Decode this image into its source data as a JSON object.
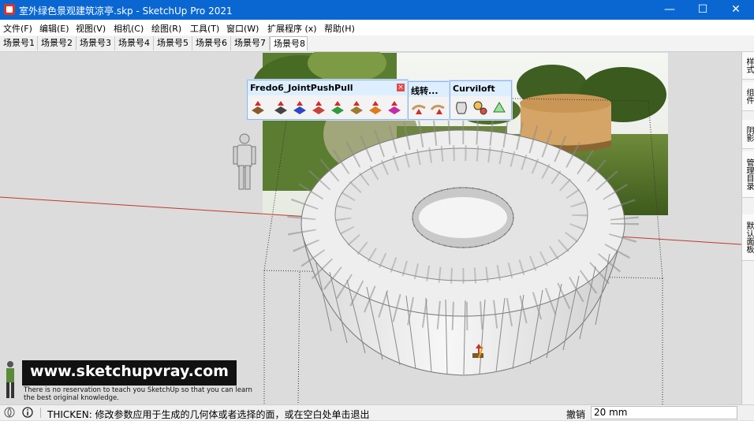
{
  "window": {
    "title": "室外绿色景观建筑凉亭.skp - SketchUp Pro 2021",
    "minimize": "—",
    "maximize": "☐",
    "close": "✕"
  },
  "menu": [
    "文件(F)",
    "编辑(E)",
    "视图(V)",
    "相机(C)",
    "绘图(R)",
    "工具(T)",
    "窗口(W)",
    "扩展程序 (x)",
    "帮助(H)"
  ],
  "scenes": {
    "tabs": [
      "场景号1",
      "场景号2",
      "场景号3",
      "场景号4",
      "场景号5",
      "场景号6",
      "场景号7",
      "场景号8"
    ],
    "active_index": 7
  },
  "toolbars": [
    {
      "title": "Fredo6_JointPushPull"
    },
    {
      "title": "线转..."
    },
    {
      "title": "Curviloft"
    }
  ],
  "tray": [
    "样式",
    "组件",
    "阴影",
    "管理目录",
    "默认面板"
  ],
  "status": {
    "message": "THICKEN: 修改参数应用于生成的几何体或者选择的面，或在空白处单击退出",
    "measure_label": "撤销",
    "measure_value": "20 mm"
  },
  "watermark": {
    "site": "www.sketchupvray.com",
    "tagline": "There is no reservation to teach you SketchUp so that you can learn the best original knowledge."
  },
  "colors": {
    "titlebar": "#0a67d2",
    "toolbar_border": "#8fb6e8",
    "axis_red": "#c0392b"
  }
}
